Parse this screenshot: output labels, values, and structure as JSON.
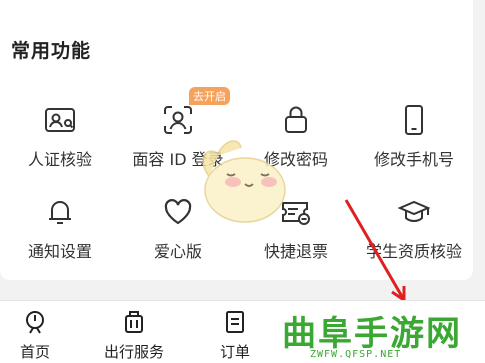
{
  "section": {
    "title": "常用功能"
  },
  "functions": [
    {
      "label": "人证核验",
      "icon": "id-card-check-icon"
    },
    {
      "label": "面容 ID 登录",
      "icon": "face-scan-icon",
      "badge": "去开启"
    },
    {
      "label": "修改密码",
      "icon": "lock-icon"
    },
    {
      "label": "修改手机号",
      "icon": "phone-icon"
    },
    {
      "label": "通知设置",
      "icon": "bell-icon"
    },
    {
      "label": "爱心版",
      "icon": "heart-icon"
    },
    {
      "label": "快捷退票",
      "icon": "ticket-refund-icon"
    },
    {
      "label": "学生资质核验",
      "icon": "graduation-cap-icon"
    }
  ],
  "tabbar": [
    {
      "label": "首页",
      "icon": "home-train-icon"
    },
    {
      "label": "出行服务",
      "icon": "luggage-icon"
    },
    {
      "label": "订单",
      "icon": "order-list-icon"
    }
  ],
  "watermark": {
    "text": "曲阜手游网",
    "url": "ZWFW.QFSP.NET"
  },
  "colors": {
    "accent": "#f5a25c",
    "watermark": "#3aa832",
    "arrow": "#e02020"
  }
}
